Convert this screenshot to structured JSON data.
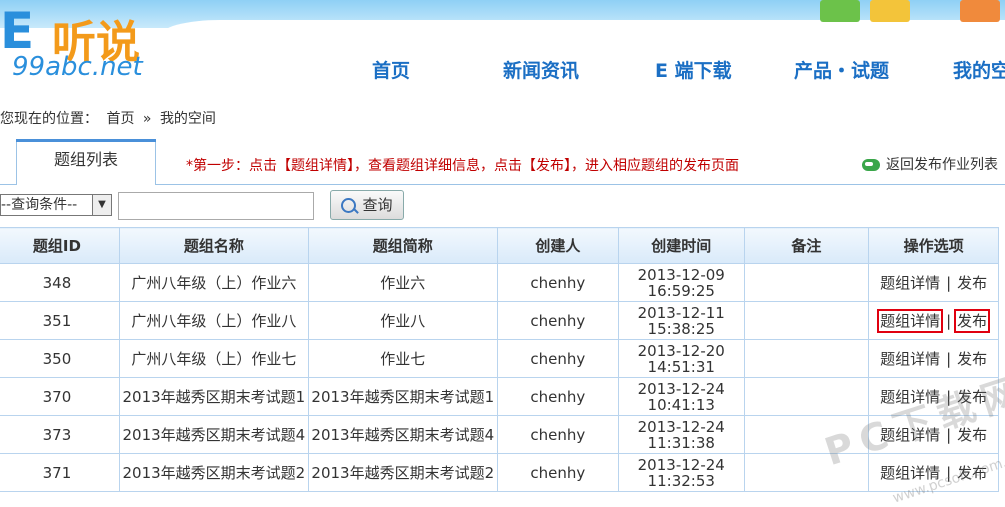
{
  "logo": {
    "e": "E",
    "cn": "听说",
    "url": "99abc.net"
  },
  "nav": [
    "首页",
    "新闻资讯",
    "E 端下载",
    "产品・试题",
    "我的空"
  ],
  "breadcrumb": {
    "prefix": "您现在的位置：",
    "home": "首页",
    "sep": "»",
    "current": "我的空间"
  },
  "tab": {
    "label": "题组列表"
  },
  "step_text": "*第一步：点击【题组详情】，查看题组详细信息，点击【发布】，进入相应题组的发布页面",
  "back_link": "返回发布作业列表",
  "search": {
    "select_value": "--查询条件--",
    "input_value": "",
    "button_label": "查询"
  },
  "table": {
    "headers": [
      "题组ID",
      "题组名称",
      "题组简称",
      "创建人",
      "创建时间",
      "备注",
      "操作选项"
    ],
    "rows": [
      {
        "id": "348",
        "name": "广州八年级（上）作业六",
        "short": "作业六",
        "creator": "chenhy",
        "date": "2013-12-09",
        "time": "16:59:25",
        "note": "",
        "detail": "题组详情",
        "sep": "|",
        "publish": "发布"
      },
      {
        "id": "351",
        "name": "广州八年级（上）作业八",
        "short": "作业八",
        "creator": "chenhy",
        "date": "2013-12-11",
        "time": "15:38:25",
        "note": "",
        "detail": "题组详情",
        "sep": "|",
        "publish": "发布"
      },
      {
        "id": "350",
        "name": "广州八年级（上）作业七",
        "short": "作业七",
        "creator": "chenhy",
        "date": "2013-12-20",
        "time": "14:51:31",
        "note": "",
        "detail": "题组详情",
        "sep": "|",
        "publish": "发布"
      },
      {
        "id": "370",
        "name": "2013年越秀区期末考试题1",
        "short": "2013年越秀区期末考试题1",
        "creator": "chenhy",
        "date": "2013-12-24",
        "time": "10:41:13",
        "note": "",
        "detail": "题组详情",
        "sep": "|",
        "publish": "发布"
      },
      {
        "id": "373",
        "name": "2013年越秀区期末考试题4",
        "short": "2013年越秀区期末考试题4",
        "creator": "chenhy",
        "date": "2013-12-24",
        "time": "11:31:38",
        "note": "",
        "detail": "题组详情",
        "sep": "|",
        "publish": "发布"
      },
      {
        "id": "371",
        "name": "2013年越秀区期末考试题2",
        "short": "2013年越秀区期末考试题2",
        "creator": "chenhy",
        "date": "2013-12-24",
        "time": "11:32:53",
        "note": "",
        "detail": "题组详情",
        "sep": "|",
        "publish": "发布"
      }
    ]
  },
  "watermark": {
    "main": "PC下载网",
    "sub": "www.pcsoft.com.cn"
  },
  "colors": {
    "nav": "#1b6fc4",
    "step": "#c00000",
    "highlight": "#e0000f",
    "header_band": "#8fd0f5"
  }
}
